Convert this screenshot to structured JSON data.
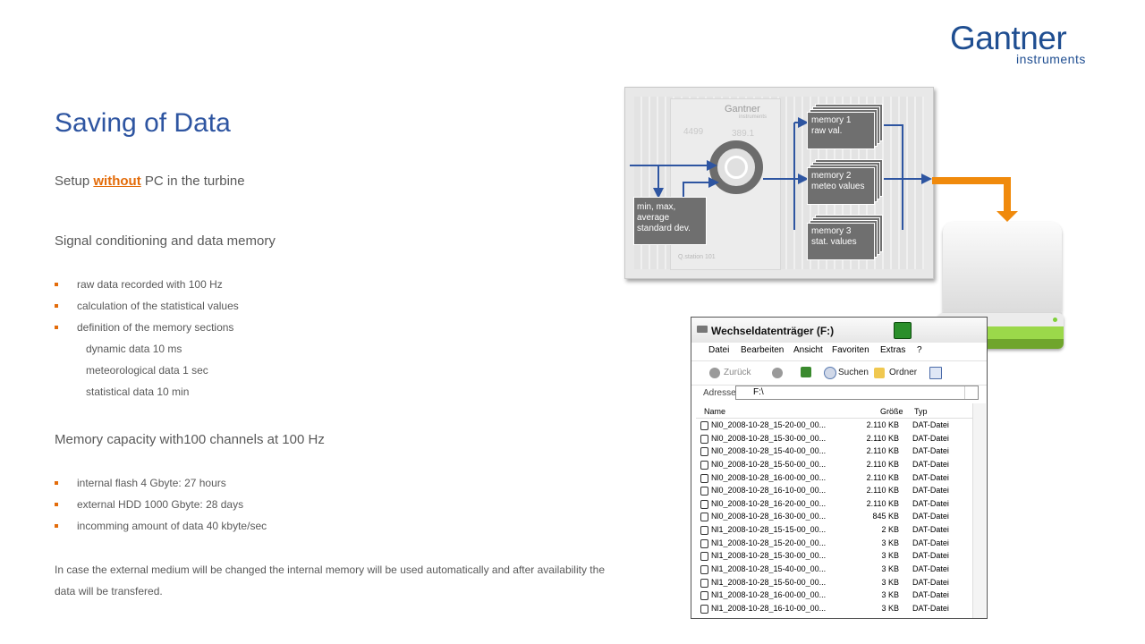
{
  "logo": {
    "main": "Gantner",
    "sub": "instruments"
  },
  "title": "Saving of Data",
  "setup": {
    "pre": "Setup ",
    "em": "without",
    "post": " PC in the turbine"
  },
  "section1": {
    "heading": "Signal conditioning and data memory",
    "bullets": [
      "raw data recorded with 100 Hz",
      "calculation of the statistical values",
      "definition of the memory sections"
    ],
    "subitems": [
      "dynamic data 10 ms",
      "meteorological data 1 sec",
      "statistical data 10 min"
    ]
  },
  "section2": {
    "heading": "Memory capacity with100 channels at 100 Hz",
    "bullets": [
      "internal flash 4 Gbyte: 27 hours",
      "external HDD 1000 Gbyte: 28 days",
      "incomming amount of data 40 kbyte/sec"
    ]
  },
  "paragraph": "In case the external medium will be changed the internal memory will be used automatically and after availability the data will be transfered.",
  "diagram": {
    "device_brand": "Gantner",
    "device_sub": "instruments",
    "device_readout1": "4499",
    "device_readout2": "389.1",
    "device_model": "Q.station 101",
    "stat_box": [
      "min, max,",
      "average",
      "standard dev."
    ],
    "memories": [
      {
        "l1": "memory 1",
        "l2": "raw val."
      },
      {
        "l1": "memory 2",
        "l2": "meteo  values"
      },
      {
        "l1": "memory 3",
        "l2": "stat. values"
      }
    ],
    "arrow_color": "#2e55a1",
    "hdd_arrow_color": "#f08a0c"
  },
  "explorer": {
    "title": "Wechseldatenträger (F:)",
    "menu": [
      "Datei",
      "Bearbeiten",
      "Ansicht",
      "Favoriten",
      "Extras",
      "?"
    ],
    "toolbar": {
      "back": "Zurück",
      "search": "Suchen",
      "folders": "Ordner"
    },
    "address_label": "Adresse",
    "address_value": "F:\\",
    "columns": {
      "name": "Name",
      "size": "Größe",
      "type": "Typ"
    },
    "files": [
      {
        "name": "Nl0_2008-10-28_15-20-00_00...",
        "size": "2.110 KB",
        "type": "DAT-Datei"
      },
      {
        "name": "Nl0_2008-10-28_15-30-00_00...",
        "size": "2.110 KB",
        "type": "DAT-Datei"
      },
      {
        "name": "Nl0_2008-10-28_15-40-00_00...",
        "size": "2.110 KB",
        "type": "DAT-Datei"
      },
      {
        "name": "Nl0_2008-10-28_15-50-00_00...",
        "size": "2.110 KB",
        "type": "DAT-Datei"
      },
      {
        "name": "Nl0_2008-10-28_16-00-00_00...",
        "size": "2.110 KB",
        "type": "DAT-Datei"
      },
      {
        "name": "Nl0_2008-10-28_16-10-00_00...",
        "size": "2.110 KB",
        "type": "DAT-Datei"
      },
      {
        "name": "Nl0_2008-10-28_16-20-00_00...",
        "size": "2.110 KB",
        "type": "DAT-Datei"
      },
      {
        "name": "Nl0_2008-10-28_16-30-00_00...",
        "size": "845 KB",
        "type": "DAT-Datei"
      },
      {
        "name": "Nl1_2008-10-28_15-15-00_00...",
        "size": "2 KB",
        "type": "DAT-Datei"
      },
      {
        "name": "Nl1_2008-10-28_15-20-00_00...",
        "size": "3 KB",
        "type": "DAT-Datei"
      },
      {
        "name": "Nl1_2008-10-28_15-30-00_00...",
        "size": "3 KB",
        "type": "DAT-Datei"
      },
      {
        "name": "Nl1_2008-10-28_15-40-00_00...",
        "size": "3 KB",
        "type": "DAT-Datei"
      },
      {
        "name": "Nl1_2008-10-28_15-50-00_00...",
        "size": "3 KB",
        "type": "DAT-Datei"
      },
      {
        "name": "Nl1_2008-10-28_16-00-00_00...",
        "size": "3 KB",
        "type": "DAT-Datei"
      },
      {
        "name": "Nl1_2008-10-28_16-10-00_00...",
        "size": "3 KB",
        "type": "DAT-Datei"
      }
    ]
  }
}
